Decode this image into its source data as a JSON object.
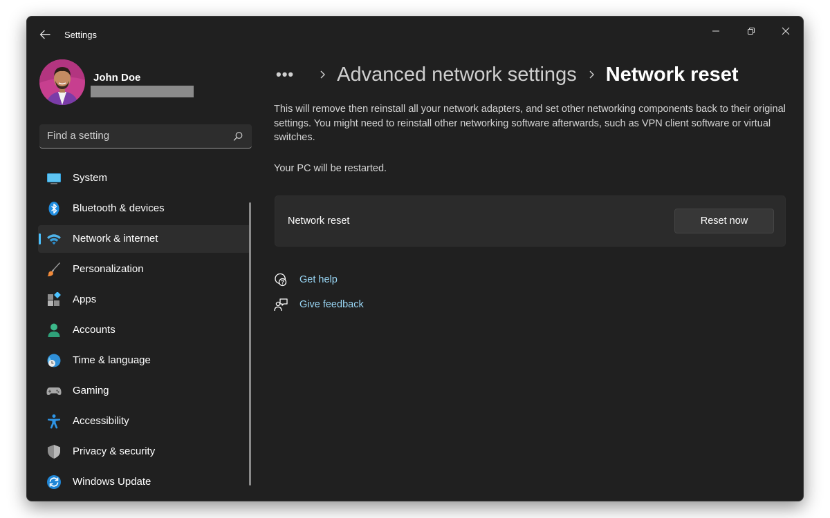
{
  "app": {
    "title": "Settings"
  },
  "user": {
    "name": "John Doe"
  },
  "search": {
    "placeholder": "Find a setting"
  },
  "nav": {
    "items": [
      {
        "label": "System",
        "icon": "system-icon"
      },
      {
        "label": "Bluetooth & devices",
        "icon": "bluetooth-icon"
      },
      {
        "label": "Network & internet",
        "icon": "wifi-icon",
        "active": true
      },
      {
        "label": "Personalization",
        "icon": "brush-icon"
      },
      {
        "label": "Apps",
        "icon": "apps-icon"
      },
      {
        "label": "Accounts",
        "icon": "person-icon"
      },
      {
        "label": "Time & language",
        "icon": "globe-clock-icon"
      },
      {
        "label": "Gaming",
        "icon": "gamepad-icon"
      },
      {
        "label": "Accessibility",
        "icon": "accessibility-icon"
      },
      {
        "label": "Privacy & security",
        "icon": "shield-icon"
      },
      {
        "label": "Windows Update",
        "icon": "update-icon"
      }
    ]
  },
  "breadcrumb": {
    "more": "•••",
    "parent": "Advanced network settings",
    "current": "Network reset"
  },
  "content": {
    "description": "This will remove then reinstall all your network adapters, and set other networking components back to their original settings. You might need to reinstall other networking software afterwards, such as VPN client software or virtual switches.",
    "restart_note": "Your PC will be restarted.",
    "card_label": "Network reset",
    "reset_button": "Reset now"
  },
  "links": {
    "help": "Get help",
    "feedback": "Give feedback"
  },
  "colors": {
    "accent": "#4cc2ff",
    "link": "#99d6f5",
    "background": "#202020",
    "card": "#2b2b2b"
  }
}
